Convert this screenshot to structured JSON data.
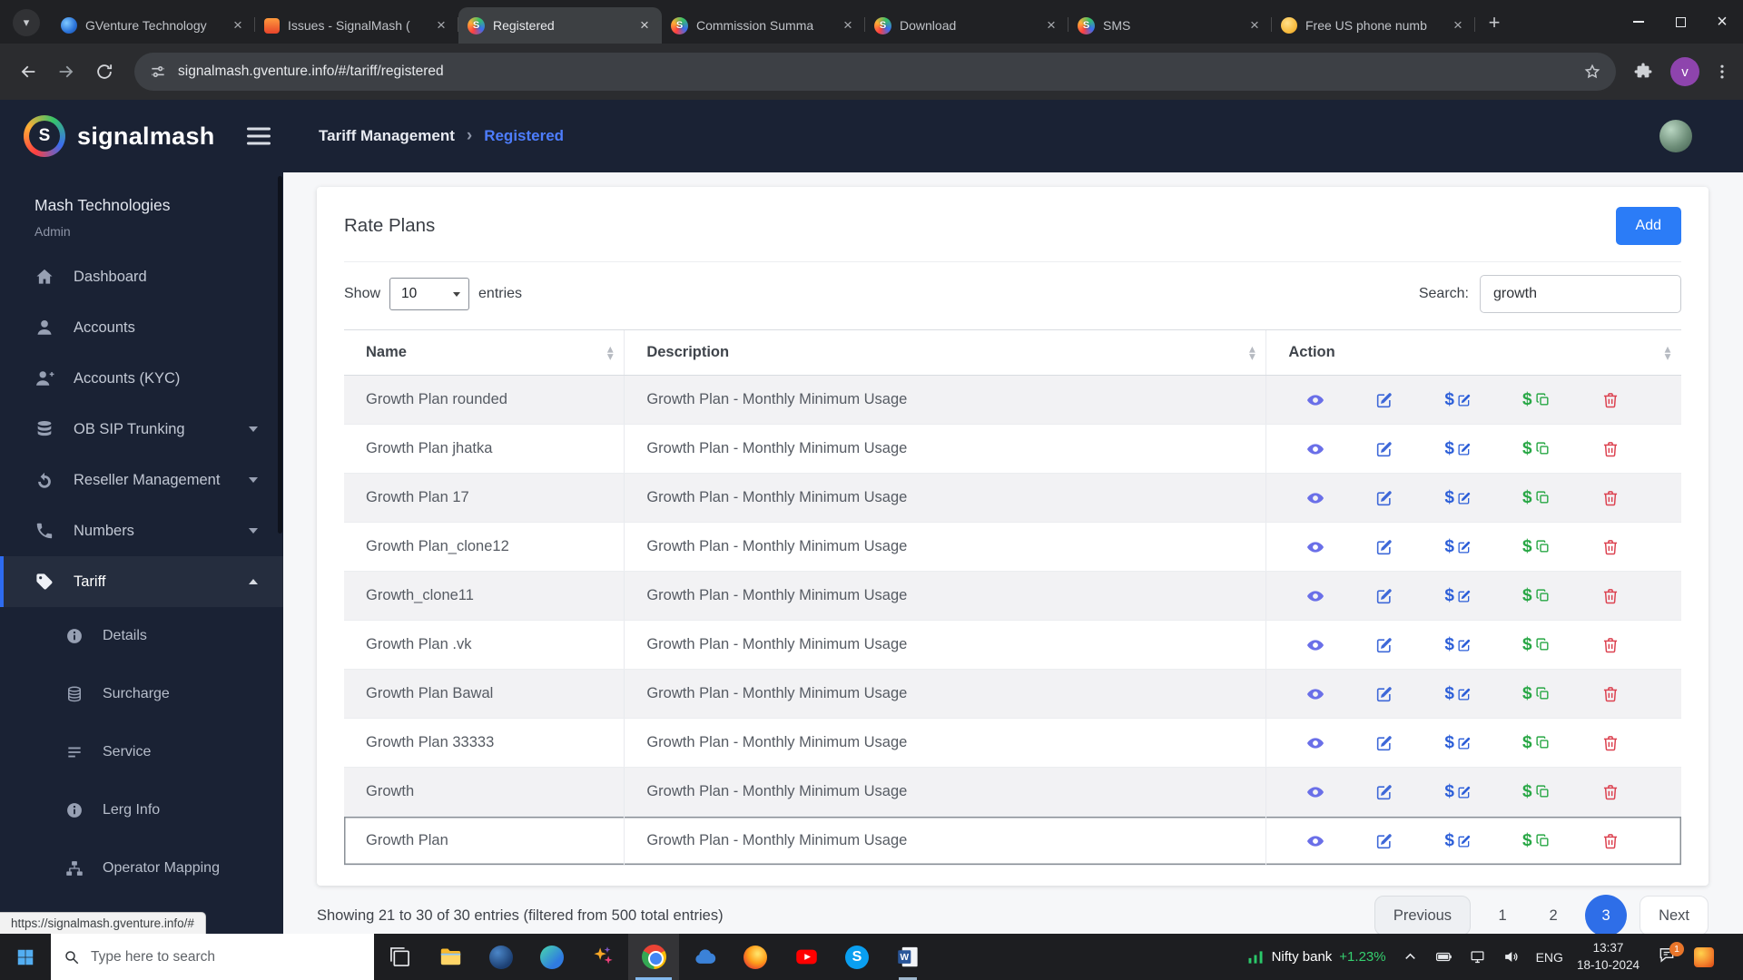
{
  "theme": {
    "accent": "#2b7cf7",
    "navy": "#1a2234",
    "green": "#28a745",
    "red": "#dc3545",
    "indigo": "#6a6fe8"
  },
  "browser": {
    "tabs": [
      {
        "title": "GVenture Technology",
        "favicon": "gventure-favicon"
      },
      {
        "title": "Issues - SignalMash (",
        "favicon": "flame-favicon"
      },
      {
        "title": "Registered",
        "favicon": "signalmash-favicon",
        "active": true
      },
      {
        "title": "Commission Summa",
        "favicon": "signalmash-favicon"
      },
      {
        "title": "Download",
        "favicon": "signalmash-favicon"
      },
      {
        "title": "SMS",
        "favicon": "signalmash-favicon"
      },
      {
        "title": "Free US phone numb",
        "favicon": "phone-favicon"
      }
    ],
    "url": "signalmash.gventure.info/#/tariff/registered",
    "profile_initial": "v"
  },
  "header": {
    "breadcrumb_root": "Tariff Management",
    "breadcrumb_sep": "›",
    "breadcrumb_current": "Registered"
  },
  "sidebar": {
    "brand": "signalmash",
    "brand_initial": "S",
    "org": "Mash Technologies",
    "role": "Admin",
    "items": [
      {
        "label": "Dashboard",
        "icon": "home-icon"
      },
      {
        "label": "Accounts",
        "icon": "user-icon"
      },
      {
        "label": "Accounts (KYC)",
        "icon": "user-plus-icon"
      },
      {
        "label": "OB SIP Trunking",
        "icon": "server-icon",
        "chevron": "down"
      },
      {
        "label": "Reseller Management",
        "icon": "sync-icon",
        "chevron": "down"
      },
      {
        "label": "Numbers",
        "icon": "phone-icon",
        "chevron": "down"
      },
      {
        "label": "Tariff",
        "icon": "tag-icon",
        "chevron": "up",
        "active": true
      },
      {
        "label": "Details",
        "icon": "info-icon",
        "sub": true
      },
      {
        "label": "Surcharge",
        "icon": "coins-icon",
        "sub": true
      },
      {
        "label": "Service",
        "icon": "list-icon",
        "sub": true
      },
      {
        "label": "Lerg Info",
        "icon": "info-icon",
        "sub": true
      },
      {
        "label": "Operator Mapping",
        "icon": "sitemap-icon",
        "sub": true
      }
    ],
    "status_link": "https://signalmash.gventure.info/#"
  },
  "main": {
    "title": "Rate Plans",
    "add_button": "Add",
    "show_label": "Show",
    "page_size": "10",
    "entries_label": "entries",
    "search_label": "Search:",
    "search_value": "growth",
    "table": {
      "columns": [
        {
          "label": "Name"
        },
        {
          "label": "Description"
        },
        {
          "label": "Action"
        }
      ],
      "action_icons": [
        "view-icon",
        "edit-icon",
        "rate-edit-icon",
        "rate-copy-icon",
        "delete-icon"
      ],
      "rows": [
        {
          "name": "Growth Plan rounded",
          "description": "Growth Plan - Monthly Minimum Usage"
        },
        {
          "name": "Growth Plan jhatka",
          "description": "Growth Plan - Monthly Minimum Usage"
        },
        {
          "name": "Growth Plan 17",
          "description": "Growth Plan - Monthly Minimum Usage"
        },
        {
          "name": "Growth Plan_clone12",
          "description": "Growth Plan - Monthly Minimum Usage"
        },
        {
          "name": "Growth_clone11",
          "description": "Growth Plan - Monthly Minimum Usage"
        },
        {
          "name": "Growth Plan .vk",
          "description": "Growth Plan - Monthly Minimum Usage"
        },
        {
          "name": "Growth Plan Bawal",
          "description": "Growth Plan - Monthly Minimum Usage"
        },
        {
          "name": "Growth Plan 33333",
          "description": "Growth Plan - Monthly Minimum Usage"
        },
        {
          "name": "Growth",
          "description": "Growth Plan - Monthly Minimum Usage"
        },
        {
          "name": "Growth Plan",
          "description": "Growth Plan - Monthly Minimum Usage"
        }
      ]
    },
    "footer_text": "Showing 21 to 30 of 30 entries (filtered from 500 total entries)",
    "pagination": {
      "items": [
        {
          "label": "Previous",
          "type": "prev"
        },
        {
          "label": "1"
        },
        {
          "label": "2"
        },
        {
          "label": "3",
          "active": true
        },
        {
          "label": "Next",
          "type": "next"
        }
      ]
    }
  },
  "taskbar": {
    "search_placeholder": "Type here to search",
    "apps": [
      {
        "icon": "task-view-icon"
      },
      {
        "icon": "file-explorer-icon"
      },
      {
        "icon": "sphere-icon"
      },
      {
        "icon": "edge-icon"
      },
      {
        "icon": "sparkle-icon"
      },
      {
        "icon": "chrome-icon",
        "active": true
      },
      {
        "icon": "onedrive-icon"
      },
      {
        "icon": "firefox-icon"
      },
      {
        "icon": "youtube-icon"
      },
      {
        "icon": "skype-icon"
      },
      {
        "icon": "word-icon",
        "open": true
      }
    ],
    "ticker": {
      "name": "Nifty bank",
      "change": "+1.23%"
    },
    "tray": [
      {
        "icon": "chevron-up-icon"
      },
      {
        "icon": "battery-icon"
      },
      {
        "icon": "ethernet-icon"
      },
      {
        "icon": "volume-icon"
      }
    ],
    "lang": "ENG",
    "time": "13:37",
    "date": "18-10-2024",
    "badge": "1"
  }
}
